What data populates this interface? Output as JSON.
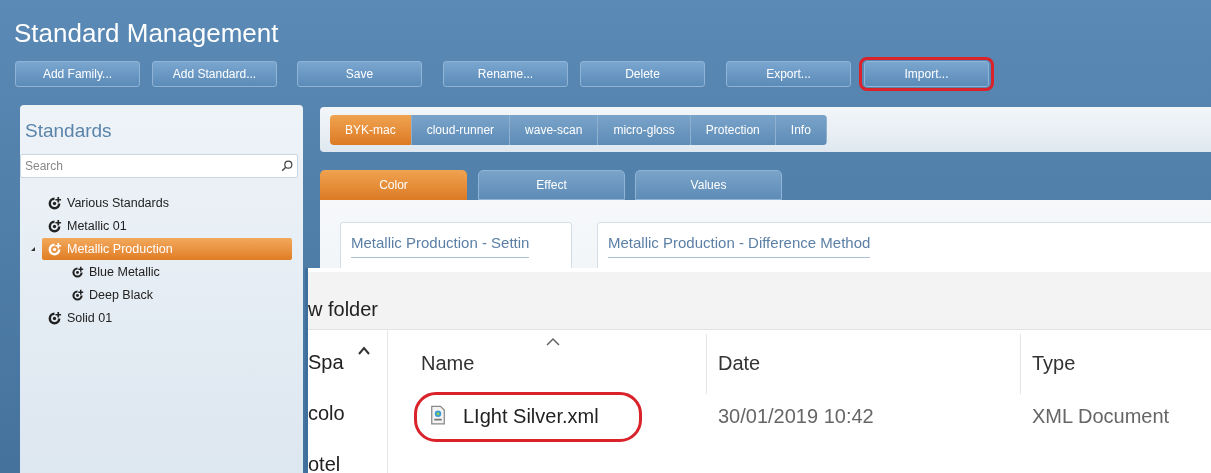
{
  "window": {
    "title": "Standard Management"
  },
  "toolbar": [
    {
      "label": "Add Family...",
      "annotated": false
    },
    {
      "label": "Add Standard...",
      "annotated": false
    },
    {
      "label": "Save",
      "annotated": false
    },
    {
      "label": "Rename...",
      "annotated": false
    },
    {
      "label": "Delete",
      "annotated": false
    },
    {
      "label": "Export...",
      "annotated": false
    },
    {
      "label": "Import...",
      "annotated": true
    }
  ],
  "standards_panel": {
    "title": "Standards",
    "search": {
      "placeholder": "Search"
    },
    "tree": [
      {
        "label": "Various Standards",
        "selected": false
      },
      {
        "label": "Metallic 01",
        "selected": false
      },
      {
        "label": "Metallic Production",
        "selected": true,
        "expanded": true,
        "children": [
          {
            "label": "Blue Metallic",
            "selected": false
          },
          {
            "label": "Deep Black",
            "selected": false
          }
        ]
      },
      {
        "label": "Solid 01",
        "selected": false
      }
    ]
  },
  "device_tabs": [
    {
      "label": "BYK-mac",
      "selected": true
    },
    {
      "label": "cloud-runner",
      "selected": false
    },
    {
      "label": "wave-scan",
      "selected": false
    },
    {
      "label": "micro-gloss",
      "selected": false
    },
    {
      "label": "Protection",
      "selected": false
    },
    {
      "label": "Info",
      "selected": false
    }
  ],
  "view_tabs": [
    {
      "label": "Color",
      "selected": true
    },
    {
      "label": "Effect",
      "selected": false
    },
    {
      "label": "Values",
      "selected": false
    }
  ],
  "sections": [
    {
      "title": "Metallic Production - Settin"
    },
    {
      "title": "Metallic Production - Difference Method"
    }
  ],
  "file_dialog": {
    "path": "w folder",
    "nav_items": [
      "Spa",
      "colo",
      "otel"
    ],
    "columns": [
      {
        "label": "Name",
        "sorted": true
      },
      {
        "label": "Date",
        "sorted": false
      },
      {
        "label": "Type",
        "sorted": false
      }
    ],
    "files": [
      {
        "name": "LIght Silver.xml",
        "date": "30/01/2019 10:42",
        "type": "XML Document",
        "annotated": true
      }
    ]
  }
}
